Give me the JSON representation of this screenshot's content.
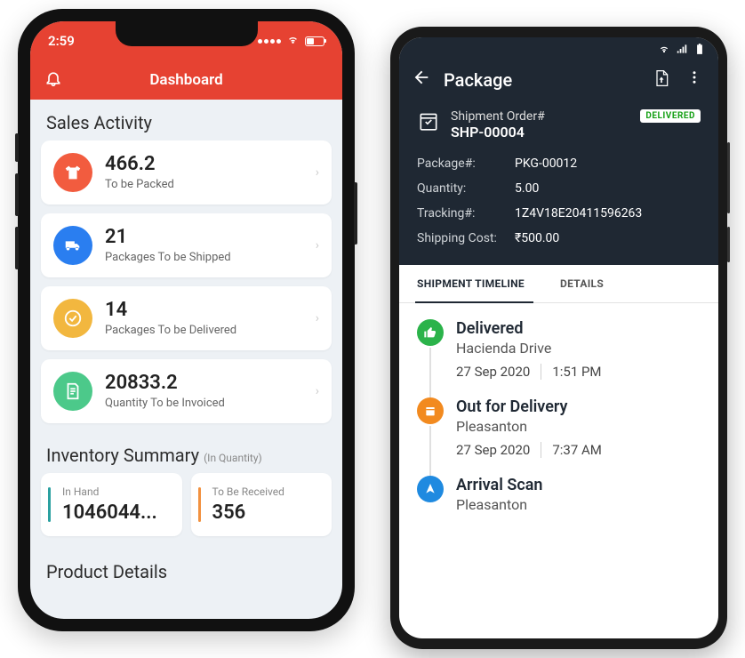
{
  "left": {
    "status_time": "2:59",
    "header_title": "Dashboard",
    "sales_title": "Sales Activity",
    "cards": [
      {
        "value": "466.2",
        "label": "To be Packed"
      },
      {
        "value": "21",
        "label": "Packages To be Shipped"
      },
      {
        "value": "14",
        "label": "Packages To be Delivered"
      },
      {
        "value": "20833.2",
        "label": "Quantity To be Invoiced"
      }
    ],
    "inv_title": "Inventory Summary",
    "inv_sub": "(In Quantity)",
    "inv": [
      {
        "label": "In Hand",
        "value": "1046044..."
      },
      {
        "label": "To Be Received",
        "value": "356"
      }
    ],
    "product_title": "Product Details"
  },
  "right": {
    "header_title": "Package",
    "ship_label": "Shipment Order#",
    "ship_num": "SHP-00004",
    "badge": "DELIVERED",
    "meta": {
      "package_k": "Package#:",
      "package_v": "PKG-00012",
      "qty_k": "Quantity:",
      "qty_v": "5.00",
      "track_k": "Tracking#:",
      "track_v": "1Z4V18E20411596263",
      "cost_k": "Shipping Cost:",
      "cost_v": "₹500.00"
    },
    "tabs": {
      "timeline": "SHIPMENT TIMELINE",
      "details": "DETAILS"
    },
    "timeline": [
      {
        "title": "Delivered",
        "loc": "Hacienda Drive",
        "date": "27 Sep 2020",
        "time": "1:51 PM"
      },
      {
        "title": "Out for Delivery",
        "loc": "Pleasanton",
        "date": "27 Sep 2020",
        "time": "7:37 AM"
      },
      {
        "title": "Arrival Scan",
        "loc": "Pleasanton",
        "date": "",
        "time": ""
      }
    ]
  }
}
